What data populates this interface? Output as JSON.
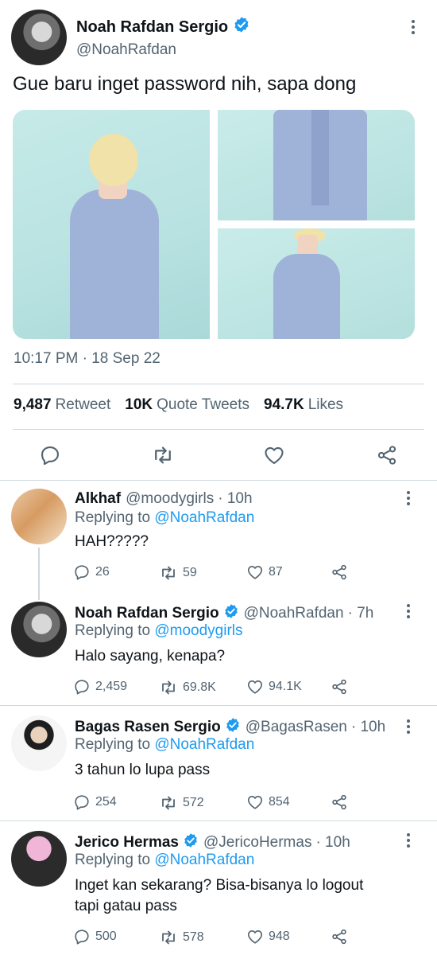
{
  "main_tweet": {
    "name": "Noah Rafdan Sergio",
    "handle": "@NoahRafdan",
    "text": "Gue baru inget password nih, sapa dong",
    "timestamp": "10:17 PM · 18 Sep 22",
    "stats": {
      "retweets": "9,487",
      "retweets_label": "Retweet",
      "quotes": "10K",
      "quotes_label": "Quote Tweets",
      "likes": "94.7K",
      "likes_label": "Likes"
    }
  },
  "replies": [
    {
      "name": "Alkhaf",
      "handle": "@moodygirls",
      "time": "· 10h",
      "replying_label": "Replying to",
      "replying_to": "@NoahRafdan",
      "text": "HAH?????",
      "replies": "26",
      "retweets": "59",
      "likes": "87",
      "verified": false
    },
    {
      "name": "Noah Rafdan Sergio",
      "handle": "@NoahRafdan",
      "time": "· 7h",
      "replying_label": "Replying to",
      "replying_to": "@moodygirls",
      "text": "Halo sayang, kenapa?",
      "replies": "2,459",
      "retweets": "69.8K",
      "likes": "94.1K",
      "verified": true
    },
    {
      "name": "Bagas Rasen Sergio",
      "handle": "@BagasRasen",
      "time": "· 10h",
      "replying_label": "Replying to",
      "replying_to": "@NoahRafdan",
      "text": "3 tahun lo lupa pass",
      "replies": "254",
      "retweets": "572",
      "likes": "854",
      "verified": true
    },
    {
      "name": "Jerico Hermas",
      "handle": "@JericoHermas",
      "time": "· 10h",
      "replying_label": "Replying to",
      "replying_to": "@NoahRafdan",
      "text_line1": "Inget kan sekarang? Bisa-bisanya lo logout",
      "text_line2": "tapi gatau pass",
      "replies": "500",
      "retweets": "578",
      "likes": "948",
      "verified": true
    }
  ],
  "colors": {
    "accent": "#1d9bf0",
    "text_primary": "#0f1419",
    "text_secondary": "#536471",
    "divider": "#cfd9de"
  },
  "icons": [
    "verified-badge-icon",
    "more-options-icon",
    "reply-icon",
    "retweet-icon",
    "like-icon",
    "share-icon"
  ]
}
